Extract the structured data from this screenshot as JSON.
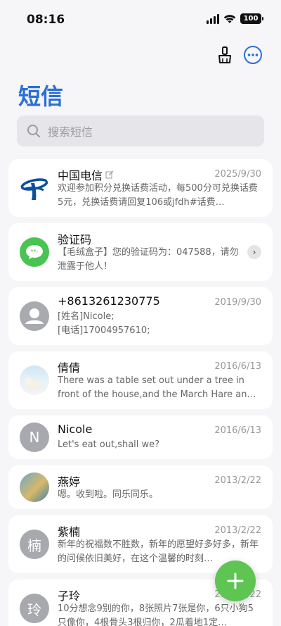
{
  "status": {
    "time": "08:16",
    "battery": "100"
  },
  "header": {
    "title": "短信"
  },
  "search": {
    "placeholder": "搜索短信"
  },
  "conversations": [
    {
      "name": "中国电信",
      "date": "2025/9/30",
      "preview": "欢迎参加积分兑换话费活动，每500分可兑换话费5元，兑换话费请回复106或jfdh#话费…"
    },
    {
      "name": "验证码",
      "date": "",
      "preview": "【毛绒盒子】您的验证码为：047588，请勿泄露于他人！"
    },
    {
      "name": "+8613261230775",
      "date": "2019/9/30",
      "preview_lines": [
        "[姓名]Nicole;",
        "[电话]17004957610;"
      ]
    },
    {
      "name": "倩倩",
      "date": "2016/6/13",
      "preview": "There was a table set out under a tree in front of the house,and the March Hare an…"
    },
    {
      "name": "Nicole",
      "date": "2016/6/13",
      "preview": "Let's eat out,shall we?",
      "avatar_letter": "N"
    },
    {
      "name": "燕婷",
      "date": "2013/2/22",
      "preview": "嗯。收到啦。同乐同乐。"
    },
    {
      "name": "紫楠",
      "date": "2013/2/22",
      "preview": "新年的祝福数不胜数，新年的愿望好多好多，新年的问候依旧美好，在这个温馨的时刻…",
      "avatar_letter": "楠"
    },
    {
      "name": "子玲",
      "date": "2013/2/22",
      "preview": "10分想念9别的你，8张照片7张是你，6只小狗5只像你，4根骨头3根归你，2瓜着地1定…",
      "avatar_letter": "玲"
    }
  ],
  "colors": {
    "accent": "#2b6fd6",
    "fab": "#5ec452"
  }
}
